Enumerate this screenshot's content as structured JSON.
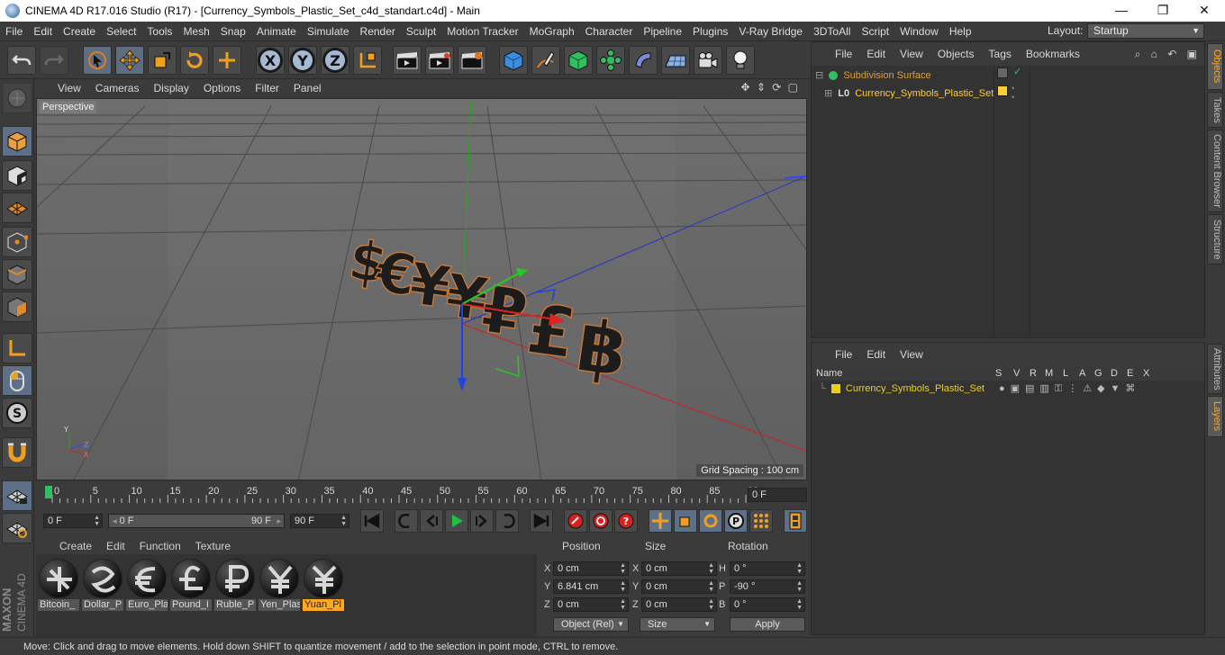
{
  "window": {
    "title": "CINEMA 4D R17.016 Studio (R17) - [Currency_Symbols_Plastic_Set_c4d_standart.c4d] - Main",
    "minimize": "—",
    "maximize": "❐",
    "close": "✕"
  },
  "menubar": {
    "items": [
      "File",
      "Edit",
      "Create",
      "Select",
      "Tools",
      "Mesh",
      "Snap",
      "Animate",
      "Simulate",
      "Render",
      "Sculpt",
      "Motion Tracker",
      "MoGraph",
      "Character",
      "Pipeline",
      "Plugins",
      "V-Ray Bridge",
      "3DToAll",
      "Script",
      "Window",
      "Help"
    ],
    "layout_label": "Layout:",
    "layout_value": "Startup"
  },
  "toolbar": {
    "axis_x": "X",
    "axis_y": "Y",
    "axis_z": "Z"
  },
  "viewport": {
    "menu": [
      "View",
      "Cameras",
      "Display",
      "Options",
      "Filter",
      "Panel"
    ],
    "nav_icons": "✥ ⇕ ⟳ ▢",
    "camera": "Perspective",
    "grid_spacing": "Grid Spacing : 100 cm",
    "symbols": [
      "$",
      "€",
      "¥",
      "¥",
      "₽",
      "£",
      "฿"
    ],
    "axis_labels": {
      "x": "X",
      "y": "Y",
      "z": "Z"
    }
  },
  "timeline": {
    "ticks": [
      "0",
      "5",
      "10",
      "15",
      "20",
      "25",
      "30",
      "35",
      "40",
      "45",
      "50",
      "55",
      "60",
      "65",
      "70",
      "75",
      "80",
      "85",
      "90"
    ],
    "current_frame": "0 F"
  },
  "transport": {
    "start_field": "0 F",
    "range_start": "0 F",
    "range_end": "90 F",
    "end_field": "90 F"
  },
  "materials": {
    "menu": [
      "Create",
      "Edit",
      "Function",
      "Texture"
    ],
    "items": [
      {
        "name": "Bitcoin_"
      },
      {
        "name": "Dollar_P"
      },
      {
        "name": "Euro_Pla"
      },
      {
        "name": "Pound_I"
      },
      {
        "name": "Ruble_P"
      },
      {
        "name": "Yen_Plas"
      },
      {
        "name": "Yuan_Pl",
        "selected": true
      }
    ]
  },
  "coordinates": {
    "headers": {
      "position": "Position",
      "size": "Size",
      "rotation": "Rotation"
    },
    "rows": [
      {
        "axis": "X",
        "position": "0 cm",
        "size_axis": "X",
        "size": "0 cm",
        "rot_axis": "H",
        "rotation": "0 °"
      },
      {
        "axis": "Y",
        "position": "6.841 cm",
        "size_axis": "Y",
        "size": "0 cm",
        "rot_axis": "P",
        "rotation": "-90 °"
      },
      {
        "axis": "Z",
        "position": "0 cm",
        "size_axis": "Z",
        "size": "0 cm",
        "rot_axis": "B",
        "rotation": "0 °"
      }
    ],
    "mode": "Object (Rel)",
    "size_mode": "Size",
    "apply": "Apply"
  },
  "objects_panel": {
    "menu": [
      "File",
      "Edit",
      "View",
      "Objects",
      "Tags",
      "Bookmarks"
    ],
    "icons": "⌕ ⌂ ↶ ▣",
    "rows": [
      {
        "name": "Subdivision Surface",
        "color": "#e0a030"
      },
      {
        "name": "Currency_Symbols_Plastic_Set",
        "color": "#ffcc33"
      }
    ]
  },
  "layers_panel": {
    "menu": [
      "File",
      "Edit",
      "View"
    ],
    "columns": [
      "Name",
      "S",
      "V",
      "R",
      "M",
      "L",
      "A",
      "G",
      "D",
      "E",
      "X"
    ],
    "rows": [
      {
        "name": "Currency_Symbols_Plastic_Set",
        "color": "#e8d020"
      }
    ]
  },
  "side_tabs": [
    "Objects",
    "Takes",
    "Content Browser",
    "Structure",
    "Attributes",
    "Layers"
  ],
  "statusbar": {
    "text": "Move: Click and drag to move elements. Hold down SHIFT to quantize movement / add to the selection in point mode, CTRL to remove."
  },
  "colors": {
    "accent": "#ffa824",
    "blue_tool": "#5e7088"
  }
}
